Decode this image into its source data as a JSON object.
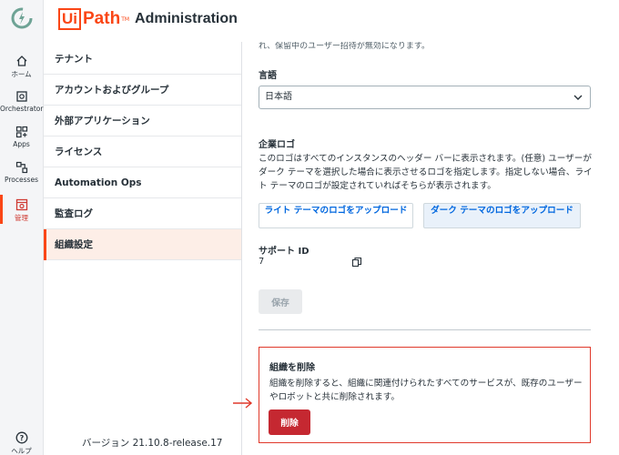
{
  "header": {
    "brand_box": "Ui",
    "brand_path": "Path",
    "brand_tm": "TM",
    "title": "Administration"
  },
  "rail": {
    "items": [
      {
        "label": "ホーム",
        "icon": "home-icon"
      },
      {
        "label": "Orchestrator",
        "icon": "orchestrator-icon"
      },
      {
        "label": "Apps",
        "icon": "apps-icon"
      },
      {
        "label": "Processes",
        "icon": "processes-icon"
      },
      {
        "label": "管理",
        "icon": "admin-icon",
        "active": true
      },
      {
        "label": "ヘルプ",
        "icon": "help-icon"
      }
    ]
  },
  "nav": {
    "items": [
      {
        "label": "テナント"
      },
      {
        "label": "アカウントおよびグループ"
      },
      {
        "label": "外部アプリケーション"
      },
      {
        "label": "ライセンス"
      },
      {
        "label": "Automation Ops"
      },
      {
        "label": "監査ログ"
      },
      {
        "label": "組織設定",
        "active": true
      }
    ],
    "version": "バージョン 21.10.8-release.17"
  },
  "main": {
    "top_cut_text": "れ、保留中のユーザー招待が無効になります。",
    "language": {
      "label": "言語",
      "value": "日本語"
    },
    "logo": {
      "label": "企業ロゴ",
      "description": "このロゴはすべてのインスタンスのヘッダー バーに表示されます。(任意) ユーザーがダーク テーマを選択した場合に表示させるロゴを指定します。指定しない場合、ライト テーマのロゴが設定されていればそちらが表示されます。",
      "light_upload": "ライト テーマのロゴをアップロード",
      "dark_upload": "ダーク テーマのロゴをアップロード"
    },
    "support": {
      "label": "サポート ID",
      "value": "                  7"
    },
    "save_label": "保存",
    "danger": {
      "title": "組織を削除",
      "text": "組織を削除すると、組織に関連付けられたすべてのサービスが、既存のユーザーやロボットと共に削除されます。",
      "delete_label": "削除"
    }
  },
  "colors": {
    "brand": "#fa4616",
    "danger": "#c52831",
    "link": "#0067df"
  }
}
